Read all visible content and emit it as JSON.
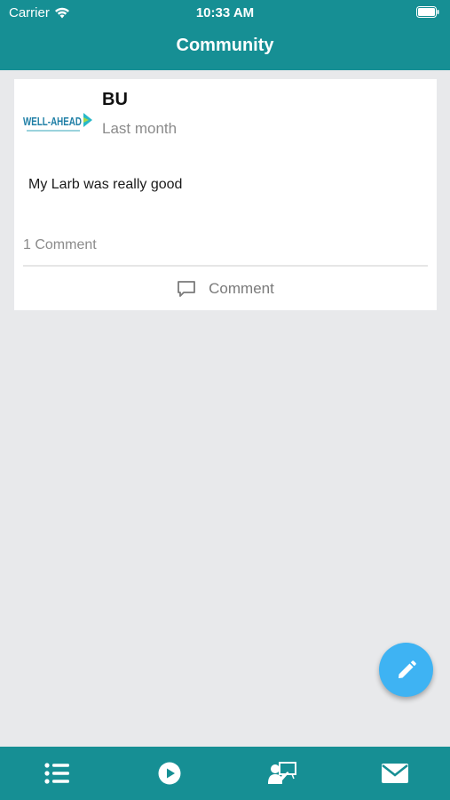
{
  "status_bar": {
    "carrier": "Carrier",
    "time": "10:33 AM"
  },
  "header": {
    "title": "Community"
  },
  "post": {
    "author": "BU",
    "time": "Last month",
    "text": "My Larb was really good",
    "comment_count": "1 Comment",
    "comment_label": "Comment",
    "logo": {
      "icon": "wellahead-logo",
      "brand_text": "WELL-AHEAD"
    }
  },
  "fab": {
    "icon": "pencil-icon"
  },
  "tabbar": {
    "items": [
      {
        "icon": "list-icon"
      },
      {
        "icon": "play-icon"
      },
      {
        "icon": "presenter-icon"
      },
      {
        "icon": "mail-icon"
      }
    ]
  },
  "colors": {
    "teal": "#168f94",
    "fab_blue": "#3eb3f3",
    "background": "#e8e9eb"
  }
}
